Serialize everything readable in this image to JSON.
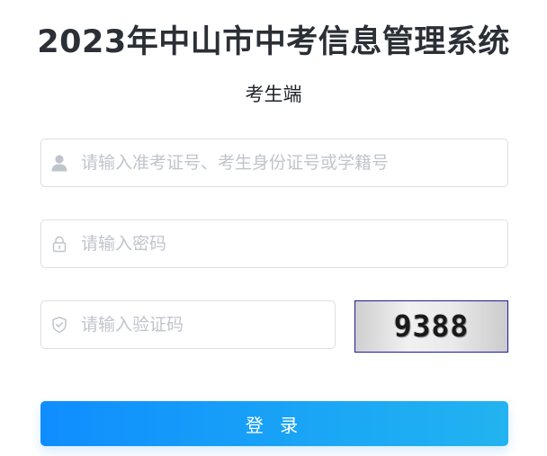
{
  "header": {
    "title": "2023年中山市中考信息管理系统",
    "subtitle": "考生端"
  },
  "form": {
    "username": {
      "placeholder": "请输入准考证号、考生身份证号或学籍号",
      "value": "",
      "icon": "user-icon"
    },
    "password": {
      "placeholder": "请输入密码",
      "value": "",
      "icon": "lock-icon"
    },
    "captcha_input": {
      "placeholder": "请输入验证码",
      "value": "",
      "icon": "shield-icon"
    },
    "captcha_image": {
      "text": "9388"
    },
    "login_button": {
      "label": "登 录"
    }
  },
  "colors": {
    "title": "#2b2f36",
    "border": "#dcdfe6",
    "placeholder": "#c0c4cc",
    "icon": "#c0c4cc",
    "button_start": "#0f8dff",
    "button_end": "#22b3f0",
    "captcha_border": "#1a1a9e"
  }
}
